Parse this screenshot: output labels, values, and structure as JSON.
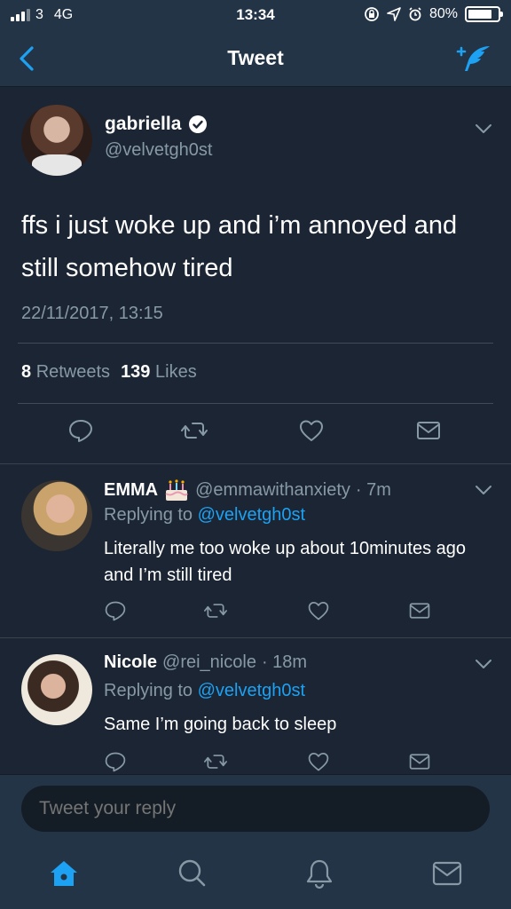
{
  "status_bar": {
    "carrier": "3",
    "network": "4G",
    "time": "13:34",
    "battery": "80%"
  },
  "nav": {
    "title": "Tweet",
    "back_icon": "chevron-left-icon",
    "compose_icon": "compose-tweet-icon"
  },
  "main_tweet": {
    "name": "gabriella",
    "handle": "@velvetgh0st",
    "text": "ffs i just woke up and i’m annoyed and still somehow tired",
    "date": "22/11/2017, 13:15",
    "retweets_count": "8",
    "retweets_label": "Retweets",
    "likes_count": "139",
    "likes_label": "Likes"
  },
  "replies": [
    {
      "name": "EMMA",
      "handle": "@emmawithanxiety",
      "time": "· 7m",
      "replying_label": "Replying to",
      "replying_to": "@velvetgh0st",
      "text": "Literally me too woke up about 10minutes ago and I’m still tired"
    },
    {
      "name": "Nicole",
      "handle": "@rei_nicole",
      "time": "· 18m",
      "replying_label": "Replying to",
      "replying_to": "@velvetgh0st",
      "text": "Same I’m going back to sleep"
    }
  ],
  "reply_box": {
    "placeholder": "Tweet your reply"
  },
  "colors": {
    "background": "#1b2533",
    "bar": "#243447",
    "accent": "#1da1f2",
    "muted": "#8899a6"
  }
}
